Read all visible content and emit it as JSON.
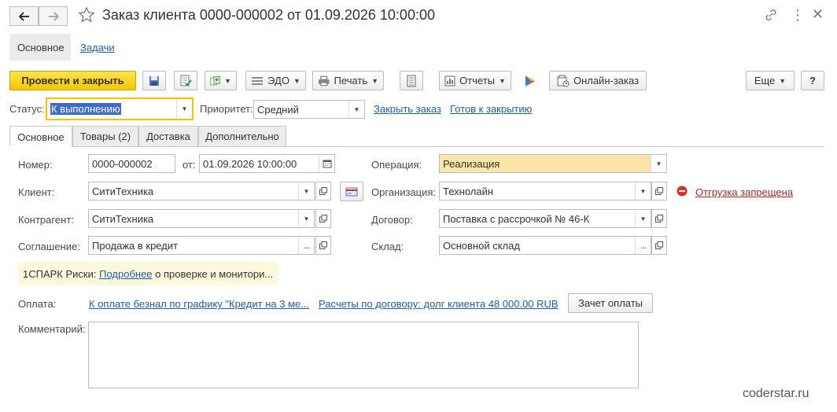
{
  "window": {
    "title": "Заказ клиента 0000-000002 от 01.09.2026 10:00:00"
  },
  "sections": {
    "main": "Основное",
    "tasks": "Задачи"
  },
  "toolbar": {
    "post_close": "Провести и закрыть",
    "edo": "ЭДО",
    "print": "Печать",
    "reports": "Отчеты",
    "online_order": "Онлайн-заказ",
    "more": "Еще",
    "help": "?"
  },
  "status": {
    "label": "Статус:",
    "value": "К выполнению",
    "priority_label": "Приоритет:",
    "priority_value": "Средний",
    "close_order_link": "Закрыть заказ",
    "ready_to_close_link": "Готов к закрытию"
  },
  "tabs": [
    {
      "label": "Основное"
    },
    {
      "label": "Товары (2)"
    },
    {
      "label": "Доставка"
    },
    {
      "label": "Дополнительно"
    }
  ],
  "form": {
    "number_label": "Номер:",
    "number_value": "0000-000002",
    "date_label": "от:",
    "date_value": "01.09.2026 10:00:00",
    "client_label": "Клиент:",
    "client_value": "СитиТехника",
    "counterparty_label": "Контрагент:",
    "counterparty_value": "СитиТехника",
    "agreement_label": "Соглашение:",
    "agreement_value": "Продажа в кредит",
    "operation_label": "Операция:",
    "operation_value": "Реализация",
    "organization_label": "Организация:",
    "organization_value": "Технолайн",
    "shipment_forbidden_link": "Отгрузка запрещена",
    "contract_label": "Договор:",
    "contract_value": "Поставка с рассрочкой № 46-К",
    "warehouse_label": "Склад:",
    "warehouse_value": "Основной склад",
    "spark_prefix": "1СПАРК Риски:",
    "spark_link": "Подробнее",
    "spark_suffix": "о проверке и монитори...",
    "payment_label": "Оплата:",
    "payment_schedule_link": "К оплате безнал по графику \"Кредит на 3 ме...",
    "payment_contract_link": "Расчеты по договору: долг клиента 48 000.00 RUB",
    "payment_offset_button": "Зачет оплаты",
    "comment_label": "Комментарий:",
    "comment_value": ""
  },
  "watermark": "coderstar.ru",
  "colors": {
    "primary_button": "#f6c800",
    "operation_field_bg": "#fbe4a8",
    "link": "#1f5ea8",
    "danger_link": "#b02828",
    "spark_bg": "#fdf8dc"
  }
}
